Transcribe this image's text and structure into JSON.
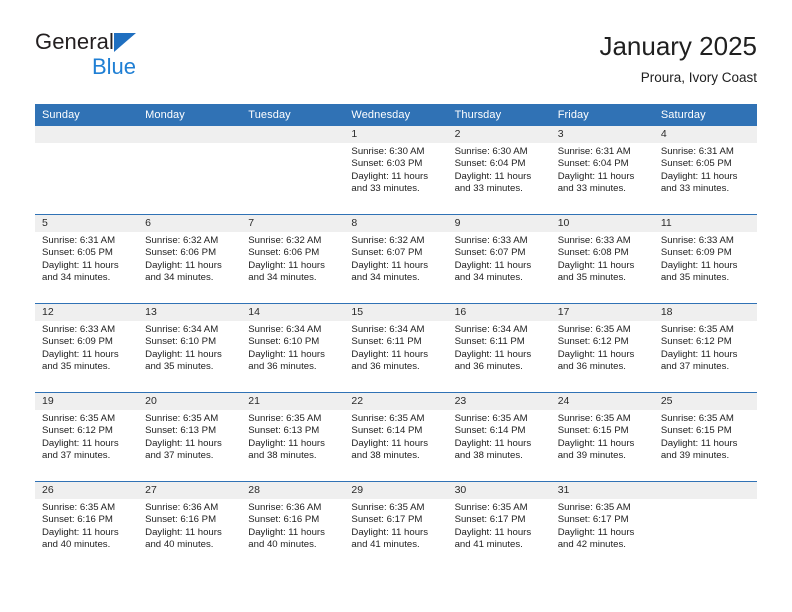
{
  "brand": {
    "name_top": "General",
    "name_bottom": "Blue",
    "triangle_color": "#1f6fc0",
    "text_color": "#231f20",
    "blue_text_color": "#1f7fd4"
  },
  "header": {
    "title": "January 2025",
    "subtitle": "Proura, Ivory Coast"
  },
  "theme": {
    "header_blue": "#3072b5",
    "daynum_band": "#efefef",
    "page_background": "#ffffff"
  },
  "calendar": {
    "weekday_headers": [
      "Sunday",
      "Monday",
      "Tuesday",
      "Wednesday",
      "Thursday",
      "Friday",
      "Saturday"
    ],
    "labels": {
      "sunrise_prefix": "Sunrise:",
      "sunset_prefix": "Sunset:",
      "daylight_prefix": "Daylight:"
    },
    "weeks": [
      [
        {
          "day": "",
          "empty": true
        },
        {
          "day": "",
          "empty": true
        },
        {
          "day": "",
          "empty": true
        },
        {
          "day": "1",
          "sunrise": "Sunrise: 6:30 AM",
          "sunset": "Sunset: 6:03 PM",
          "daylight_l1": "Daylight: 11 hours",
          "daylight_l2": "and 33 minutes."
        },
        {
          "day": "2",
          "sunrise": "Sunrise: 6:30 AM",
          "sunset": "Sunset: 6:04 PM",
          "daylight_l1": "Daylight: 11 hours",
          "daylight_l2": "and 33 minutes."
        },
        {
          "day": "3",
          "sunrise": "Sunrise: 6:31 AM",
          "sunset": "Sunset: 6:04 PM",
          "daylight_l1": "Daylight: 11 hours",
          "daylight_l2": "and 33 minutes."
        },
        {
          "day": "4",
          "sunrise": "Sunrise: 6:31 AM",
          "sunset": "Sunset: 6:05 PM",
          "daylight_l1": "Daylight: 11 hours",
          "daylight_l2": "and 33 minutes."
        }
      ],
      [
        {
          "day": "5",
          "sunrise": "Sunrise: 6:31 AM",
          "sunset": "Sunset: 6:05 PM",
          "daylight_l1": "Daylight: 11 hours",
          "daylight_l2": "and 34 minutes."
        },
        {
          "day": "6",
          "sunrise": "Sunrise: 6:32 AM",
          "sunset": "Sunset: 6:06 PM",
          "daylight_l1": "Daylight: 11 hours",
          "daylight_l2": "and 34 minutes."
        },
        {
          "day": "7",
          "sunrise": "Sunrise: 6:32 AM",
          "sunset": "Sunset: 6:06 PM",
          "daylight_l1": "Daylight: 11 hours",
          "daylight_l2": "and 34 minutes."
        },
        {
          "day": "8",
          "sunrise": "Sunrise: 6:32 AM",
          "sunset": "Sunset: 6:07 PM",
          "daylight_l1": "Daylight: 11 hours",
          "daylight_l2": "and 34 minutes."
        },
        {
          "day": "9",
          "sunrise": "Sunrise: 6:33 AM",
          "sunset": "Sunset: 6:07 PM",
          "daylight_l1": "Daylight: 11 hours",
          "daylight_l2": "and 34 minutes."
        },
        {
          "day": "10",
          "sunrise": "Sunrise: 6:33 AM",
          "sunset": "Sunset: 6:08 PM",
          "daylight_l1": "Daylight: 11 hours",
          "daylight_l2": "and 35 minutes."
        },
        {
          "day": "11",
          "sunrise": "Sunrise: 6:33 AM",
          "sunset": "Sunset: 6:09 PM",
          "daylight_l1": "Daylight: 11 hours",
          "daylight_l2": "and 35 minutes."
        }
      ],
      [
        {
          "day": "12",
          "sunrise": "Sunrise: 6:33 AM",
          "sunset": "Sunset: 6:09 PM",
          "daylight_l1": "Daylight: 11 hours",
          "daylight_l2": "and 35 minutes."
        },
        {
          "day": "13",
          "sunrise": "Sunrise: 6:34 AM",
          "sunset": "Sunset: 6:10 PM",
          "daylight_l1": "Daylight: 11 hours",
          "daylight_l2": "and 35 minutes."
        },
        {
          "day": "14",
          "sunrise": "Sunrise: 6:34 AM",
          "sunset": "Sunset: 6:10 PM",
          "daylight_l1": "Daylight: 11 hours",
          "daylight_l2": "and 36 minutes."
        },
        {
          "day": "15",
          "sunrise": "Sunrise: 6:34 AM",
          "sunset": "Sunset: 6:11 PM",
          "daylight_l1": "Daylight: 11 hours",
          "daylight_l2": "and 36 minutes."
        },
        {
          "day": "16",
          "sunrise": "Sunrise: 6:34 AM",
          "sunset": "Sunset: 6:11 PM",
          "daylight_l1": "Daylight: 11 hours",
          "daylight_l2": "and 36 minutes."
        },
        {
          "day": "17",
          "sunrise": "Sunrise: 6:35 AM",
          "sunset": "Sunset: 6:12 PM",
          "daylight_l1": "Daylight: 11 hours",
          "daylight_l2": "and 36 minutes."
        },
        {
          "day": "18",
          "sunrise": "Sunrise: 6:35 AM",
          "sunset": "Sunset: 6:12 PM",
          "daylight_l1": "Daylight: 11 hours",
          "daylight_l2": "and 37 minutes."
        }
      ],
      [
        {
          "day": "19",
          "sunrise": "Sunrise: 6:35 AM",
          "sunset": "Sunset: 6:12 PM",
          "daylight_l1": "Daylight: 11 hours",
          "daylight_l2": "and 37 minutes."
        },
        {
          "day": "20",
          "sunrise": "Sunrise: 6:35 AM",
          "sunset": "Sunset: 6:13 PM",
          "daylight_l1": "Daylight: 11 hours",
          "daylight_l2": "and 37 minutes."
        },
        {
          "day": "21",
          "sunrise": "Sunrise: 6:35 AM",
          "sunset": "Sunset: 6:13 PM",
          "daylight_l1": "Daylight: 11 hours",
          "daylight_l2": "and 38 minutes."
        },
        {
          "day": "22",
          "sunrise": "Sunrise: 6:35 AM",
          "sunset": "Sunset: 6:14 PM",
          "daylight_l1": "Daylight: 11 hours",
          "daylight_l2": "and 38 minutes."
        },
        {
          "day": "23",
          "sunrise": "Sunrise: 6:35 AM",
          "sunset": "Sunset: 6:14 PM",
          "daylight_l1": "Daylight: 11 hours",
          "daylight_l2": "and 38 minutes."
        },
        {
          "day": "24",
          "sunrise": "Sunrise: 6:35 AM",
          "sunset": "Sunset: 6:15 PM",
          "daylight_l1": "Daylight: 11 hours",
          "daylight_l2": "and 39 minutes."
        },
        {
          "day": "25",
          "sunrise": "Sunrise: 6:35 AM",
          "sunset": "Sunset: 6:15 PM",
          "daylight_l1": "Daylight: 11 hours",
          "daylight_l2": "and 39 minutes."
        }
      ],
      [
        {
          "day": "26",
          "sunrise": "Sunrise: 6:35 AM",
          "sunset": "Sunset: 6:16 PM",
          "daylight_l1": "Daylight: 11 hours",
          "daylight_l2": "and 40 minutes."
        },
        {
          "day": "27",
          "sunrise": "Sunrise: 6:36 AM",
          "sunset": "Sunset: 6:16 PM",
          "daylight_l1": "Daylight: 11 hours",
          "daylight_l2": "and 40 minutes."
        },
        {
          "day": "28",
          "sunrise": "Sunrise: 6:36 AM",
          "sunset": "Sunset: 6:16 PM",
          "daylight_l1": "Daylight: 11 hours",
          "daylight_l2": "and 40 minutes."
        },
        {
          "day": "29",
          "sunrise": "Sunrise: 6:35 AM",
          "sunset": "Sunset: 6:17 PM",
          "daylight_l1": "Daylight: 11 hours",
          "daylight_l2": "and 41 minutes."
        },
        {
          "day": "30",
          "sunrise": "Sunrise: 6:35 AM",
          "sunset": "Sunset: 6:17 PM",
          "daylight_l1": "Daylight: 11 hours",
          "daylight_l2": "and 41 minutes."
        },
        {
          "day": "31",
          "sunrise": "Sunrise: 6:35 AM",
          "sunset": "Sunset: 6:17 PM",
          "daylight_l1": "Daylight: 11 hours",
          "daylight_l2": "and 42 minutes."
        },
        {
          "day": "",
          "empty": true
        }
      ]
    ]
  }
}
